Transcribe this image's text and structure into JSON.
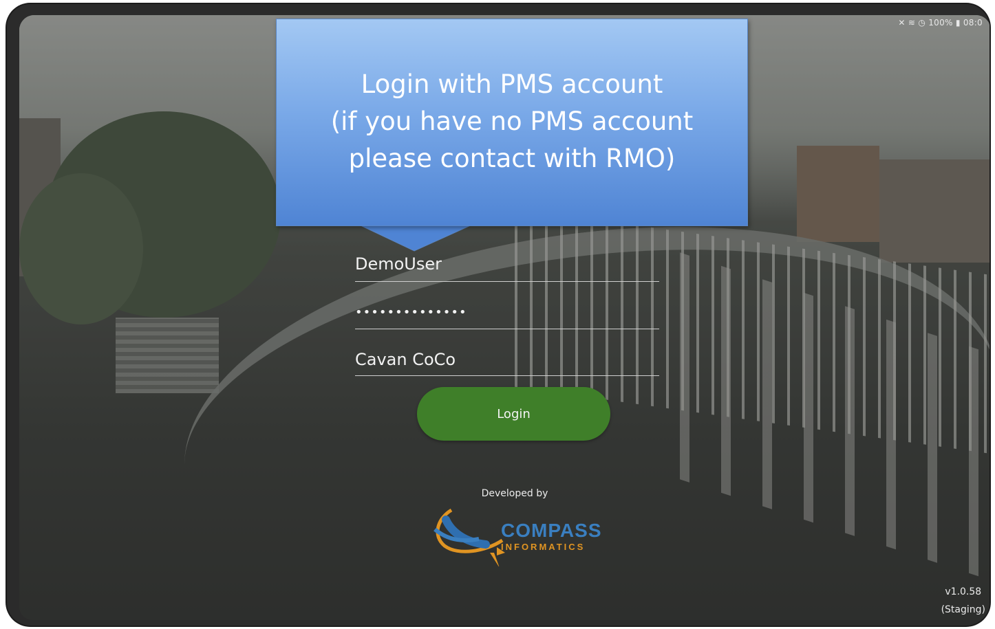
{
  "status_bar": {
    "text": "✕ ≋ ◷ 100% ▮ 08:0"
  },
  "callout": {
    "lines": [
      "Login with PMS account",
      "(if you have no PMS account",
      "please contact with RMO)"
    ]
  },
  "form": {
    "username": "DemoUser",
    "password": "••••••••••••••",
    "organisation": "Cavan CoCo",
    "login_label": "Login"
  },
  "footer": {
    "developed_by": "Developed by",
    "logo_main": "COMPASS",
    "logo_sub": "INFORMATICS",
    "version": "v1.0.58",
    "build": "(Staging)"
  },
  "colors": {
    "login_button": "#3f7f29",
    "callout_top": "#a3c8f3",
    "callout_bottom": "#4f84d4",
    "logo_blue": "#3a7fc0",
    "logo_orange": "#e09422"
  }
}
